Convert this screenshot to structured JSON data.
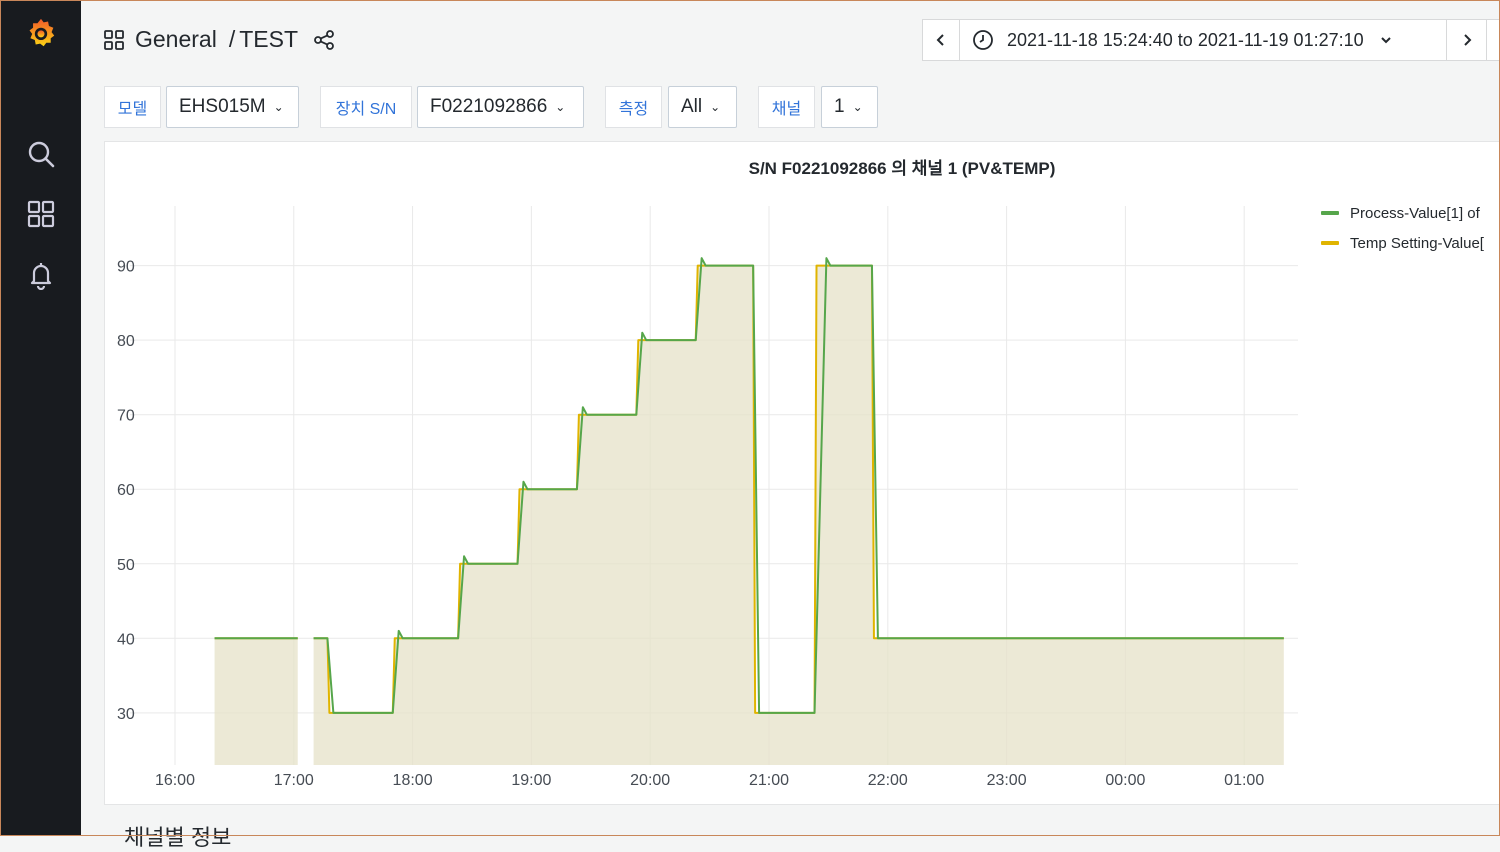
{
  "breadcrumb": {
    "folder": "General",
    "separator": "/",
    "dashboard": "TEST"
  },
  "time_range": {
    "label": "2021-11-18 15:24:40 to 2021-11-19 01:27:10"
  },
  "variables": [
    {
      "label": "모델",
      "value": "EHS015M"
    },
    {
      "label": "장치 S/N",
      "value": "F0221092866"
    },
    {
      "label": "측정",
      "value": "All"
    },
    {
      "label": "채널",
      "value": "1"
    }
  ],
  "icons": {
    "logo": "grafana-logo",
    "search": "search-icon",
    "dashboards": "dashboards-icon",
    "alerts": "bell-icon",
    "breadcrumb": "dashboards-grid-icon",
    "share": "share-icon",
    "time_back": "chevron-left-icon",
    "clock": "clock-icon",
    "dropdown": "chevron-down-icon",
    "time_forward": "chevron-right-icon"
  },
  "colors": {
    "process_value": "#56a64b",
    "temp_setting": "#e0b400",
    "fill": "#e5e1c8",
    "link": "#3274d9",
    "sidebar": "#181b1f"
  },
  "chart_data": {
    "type": "line",
    "title": "S/N F0221092866 의 채널 1 (PV&TEMP)",
    "x_ticks": [
      "16:00",
      "17:00",
      "18:00",
      "19:00",
      "20:00",
      "21:00",
      "22:00",
      "23:00",
      "00:00",
      "01:00"
    ],
    "y_ticks": [
      30,
      40,
      50,
      60,
      70,
      80,
      90
    ],
    "ylim": [
      23,
      98
    ],
    "xlim": [
      "15:24:40",
      "01:27:10"
    ],
    "grid": true,
    "legend_position": "right",
    "series": [
      {
        "name": "Process-Value[1] of",
        "points": [
          [
            "16:20",
            40
          ],
          [
            "17:02",
            40
          ],
          null,
          [
            "17:10",
            40
          ],
          [
            "17:17",
            40
          ],
          [
            "17:20",
            30
          ],
          [
            "17:50",
            30
          ],
          [
            "17:53",
            41
          ],
          [
            "17:55",
            40
          ],
          [
            "18:23",
            40
          ],
          [
            "18:26",
            51
          ],
          [
            "18:28",
            50
          ],
          [
            "18:53",
            50
          ],
          [
            "18:56",
            61
          ],
          [
            "18:58",
            60
          ],
          [
            "19:23",
            60
          ],
          [
            "19:26",
            71
          ],
          [
            "19:28",
            70
          ],
          [
            "19:53",
            70
          ],
          [
            "19:56",
            81
          ],
          [
            "19:58",
            80
          ],
          [
            "20:23",
            80
          ],
          [
            "20:26",
            91
          ],
          [
            "20:28",
            90
          ],
          [
            "20:52",
            90
          ],
          [
            "20:55",
            30
          ],
          [
            "20:57",
            30
          ],
          [
            "21:23",
            30
          ],
          [
            "21:29",
            91
          ],
          [
            "21:31",
            90
          ],
          [
            "21:52",
            90
          ],
          [
            "21:55",
            40
          ],
          [
            "01:20",
            40
          ]
        ]
      },
      {
        "name": "Temp Setting-Value[",
        "points": [
          [
            "16:20",
            40
          ],
          [
            "17:02",
            40
          ],
          null,
          [
            "17:10",
            40
          ],
          [
            "17:17",
            40
          ],
          [
            "17:18",
            30
          ],
          [
            "17:50",
            30
          ],
          [
            "17:51",
            40
          ],
          [
            "18:23",
            40
          ],
          [
            "18:24",
            50
          ],
          [
            "18:53",
            50
          ],
          [
            "18:54",
            60
          ],
          [
            "19:23",
            60
          ],
          [
            "19:24",
            70
          ],
          [
            "19:53",
            70
          ],
          [
            "19:54",
            80
          ],
          [
            "20:23",
            80
          ],
          [
            "20:24",
            90
          ],
          [
            "20:52",
            90
          ],
          [
            "20:53",
            30
          ],
          [
            "21:23",
            30
          ],
          [
            "21:24",
            90
          ],
          [
            "21:52",
            90
          ],
          [
            "21:53",
            40
          ],
          [
            "01:20",
            40
          ]
        ]
      }
    ]
  },
  "footer_text": "채널별 정보"
}
